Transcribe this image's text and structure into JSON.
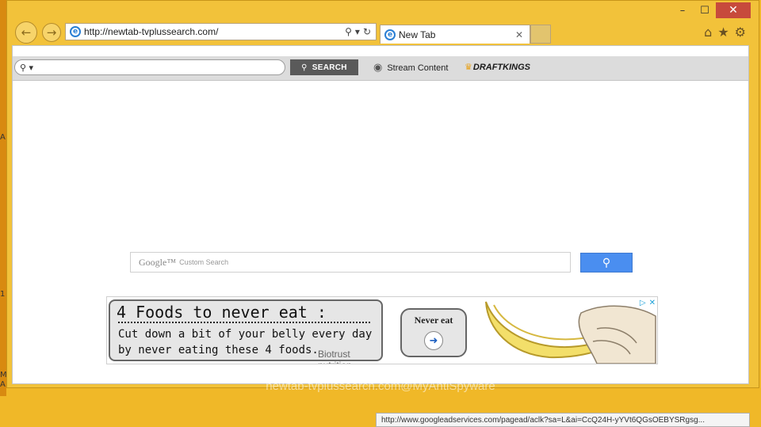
{
  "browser": {
    "address_url": "http://newtab-tvplussearch.com/",
    "tab_title": "New Tab",
    "window_controls": {
      "minimize": "–",
      "maximize": "☐",
      "close": "✕"
    },
    "nav_icons": {
      "back": "arrow-left",
      "forward": "arrow-right"
    },
    "tab_close_glyph": "✕"
  },
  "toolbar": {
    "search_placeholder": "⚲ ▾",
    "search_button": "SEARCH",
    "stream_label": "Stream Content",
    "draftkings_label": "DRAFTKINGS"
  },
  "google_search": {
    "brand": "Google™",
    "sub": "Custom Search"
  },
  "ad": {
    "headline": "4 Foods to never eat :",
    "body": "Cut down a bit of your belly every day by never eating these 4 foods.",
    "sponsor": "Biotrust nutrition",
    "cta": "Never eat"
  },
  "status_url": "http://www.googleadservices.com/pagead/aclk?sa=L&ai=CcQ24H-yYVt6QGsOEBYSRgsg...",
  "watermark": "newtab-tvplussearch.com@MyAntiSpyware",
  "desktop_letters": [
    "A",
    "1",
    "M",
    "A"
  ]
}
